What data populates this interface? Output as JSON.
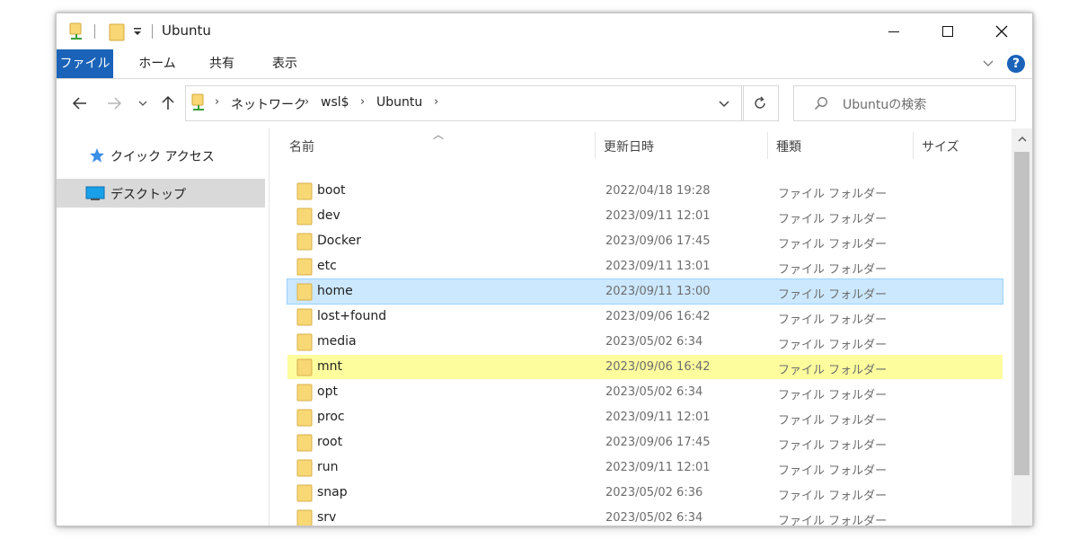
{
  "window": {
    "title": "Ubuntu",
    "controls": {
      "minimize": "minimize-icon",
      "maximize": "maximize-icon",
      "close": "close-icon"
    }
  },
  "ribbon": {
    "tabs": [
      {
        "label": "ファイル",
        "active": true
      },
      {
        "label": "ホーム"
      },
      {
        "label": "共有"
      },
      {
        "label": "表示"
      }
    ],
    "help": "?"
  },
  "address": {
    "crumbs": [
      "ネットワーク",
      "wsl$",
      "Ubuntu"
    ]
  },
  "search": {
    "placeholder": "Ubuntuの検索"
  },
  "nav": {
    "items": [
      {
        "label": "クイック アクセス",
        "icon": "star-icon"
      },
      {
        "label": "デスクトップ",
        "icon": "desktop-icon",
        "selected": true
      }
    ]
  },
  "columns": {
    "name": "名前",
    "date": "更新日時",
    "type": "種類",
    "size": "サイズ"
  },
  "files": [
    {
      "name": "boot",
      "date": "2022/04/18 19:28",
      "type": "ファイル フォルダー"
    },
    {
      "name": "dev",
      "date": "2023/09/11 12:01",
      "type": "ファイル フォルダー"
    },
    {
      "name": "Docker",
      "date": "2023/09/06 17:45",
      "type": "ファイル フォルダー"
    },
    {
      "name": "etc",
      "date": "2023/09/11 13:01",
      "type": "ファイル フォルダー"
    },
    {
      "name": "home",
      "date": "2023/09/11 13:00",
      "type": "ファイル フォルダー",
      "selected": true
    },
    {
      "name": "lost+found",
      "date": "2023/09/06 16:42",
      "type": "ファイル フォルダー"
    },
    {
      "name": "media",
      "date": "2023/05/02 6:34",
      "type": "ファイル フォルダー"
    },
    {
      "name": "mnt",
      "date": "2023/09/06 16:42",
      "type": "ファイル フォルダー",
      "highlighted": true
    },
    {
      "name": "opt",
      "date": "2023/05/02 6:34",
      "type": "ファイル フォルダー"
    },
    {
      "name": "proc",
      "date": "2023/09/11 12:01",
      "type": "ファイル フォルダー"
    },
    {
      "name": "root",
      "date": "2023/09/06 17:45",
      "type": "ファイル フォルダー"
    },
    {
      "name": "run",
      "date": "2023/09/11 12:01",
      "type": "ファイル フォルダー"
    },
    {
      "name": "snap",
      "date": "2023/05/02 6:36",
      "type": "ファイル フォルダー"
    },
    {
      "name": "srv",
      "date": "2023/05/02 6:34",
      "type": "ファイル フォルダー"
    },
    {
      "name": "",
      "date": "",
      "type": ""
    }
  ],
  "colors": {
    "accent": "#1a63b8",
    "selection": "#cce8ff",
    "highlight": "#fdfd9e",
    "folder": "#f8d775"
  }
}
